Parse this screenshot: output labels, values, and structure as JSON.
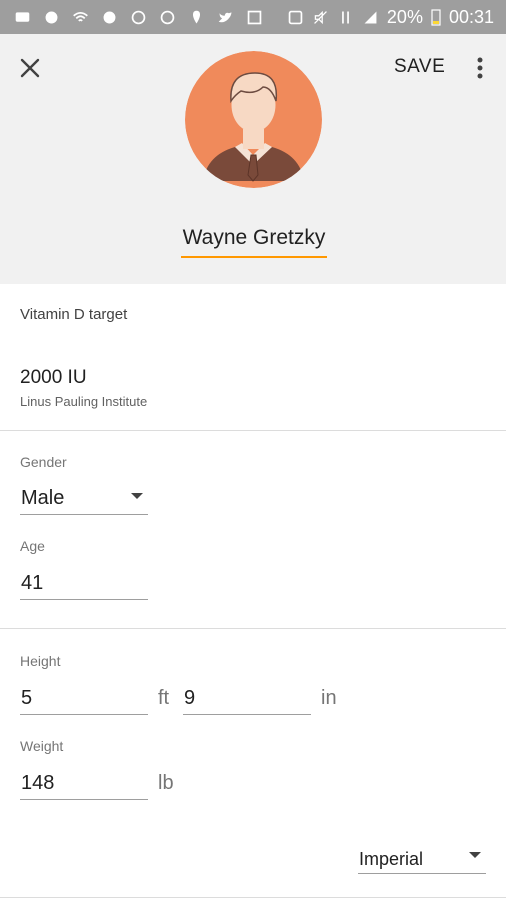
{
  "status_bar": {
    "battery": "20%",
    "time": "00:31"
  },
  "toolbar": {
    "save_label": "SAVE",
    "close_icon": "close-icon",
    "more_icon": "more-vert-icon"
  },
  "profile": {
    "name": "Wayne Gretzky",
    "accent_color": "#ff9800",
    "avatar_bg": "#f08a5b"
  },
  "vitamin": {
    "title": "Vitamin D target",
    "value": "2000 IU",
    "source": "Linus Pauling Institute"
  },
  "gender": {
    "label": "Gender",
    "value": "Male"
  },
  "age": {
    "label": "Age",
    "value": "41"
  },
  "height": {
    "label": "Height",
    "feet": "5",
    "feet_unit": "ft",
    "inches": "9",
    "inches_unit": "in"
  },
  "weight": {
    "label": "Weight",
    "value": "148",
    "unit": "lb"
  },
  "units": {
    "value": "Imperial"
  }
}
